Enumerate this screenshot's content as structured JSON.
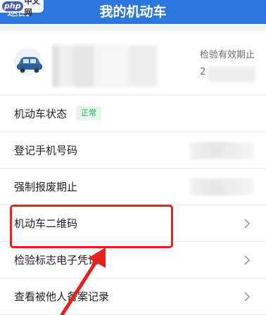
{
  "header": {
    "back_label": "返回",
    "title": "我的机动车"
  },
  "watermark": {
    "badge": "php",
    "text": "中文网"
  },
  "vehicle": {
    "inspection_label": "检验有效期止",
    "inspection_value": "2"
  },
  "rows": [
    {
      "label": "机动车状态",
      "badge": "正常"
    },
    {
      "label": "登记手机号码"
    },
    {
      "label": "强制报废期止"
    },
    {
      "label": "机动车二维码"
    },
    {
      "label": "检验标志电子凭证"
    },
    {
      "label": "查看被他人备案记录"
    }
  ],
  "colors": {
    "header_blue": "#2c76dd",
    "status_green": "#2fa862",
    "annotation_red": "#e4211b"
  }
}
